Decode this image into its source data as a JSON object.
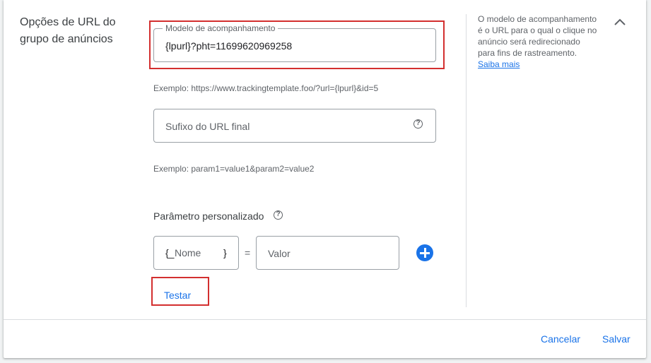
{
  "section": {
    "title": "Opções de URL do grupo de anúncios"
  },
  "tracking_template": {
    "label": "Modelo de acompanhamento",
    "value": "{lpurl}?pht=11699620969258",
    "example": "Exemplo: https://www.trackingtemplate.foo/?url={lpurl}&id=5"
  },
  "final_url_suffix": {
    "placeholder": "Sufixo do URL final",
    "example": "Exemplo: param1=value1&param2=value2"
  },
  "custom_param": {
    "label": "Parâmetro personalizado",
    "name_prefix": "{_",
    "name_placeholder": "Nome",
    "name_suffix": "}",
    "equals": "=",
    "value_placeholder": "Valor"
  },
  "actions": {
    "test_label": "Testar",
    "cancel_label": "Cancelar",
    "save_label": "Salvar"
  },
  "side_help": {
    "text": "O modelo de acompanhamento é o URL para o qual o clique no anúncio será redirecionado para fins de rastreamento.",
    "link": "Saiba mais"
  },
  "colors": {
    "accent": "#1a73e8",
    "highlight": "#d32f2f"
  },
  "icons": {
    "help": "help-circle-icon",
    "collapse": "chevron-up-icon",
    "add": "add-circle-icon"
  }
}
